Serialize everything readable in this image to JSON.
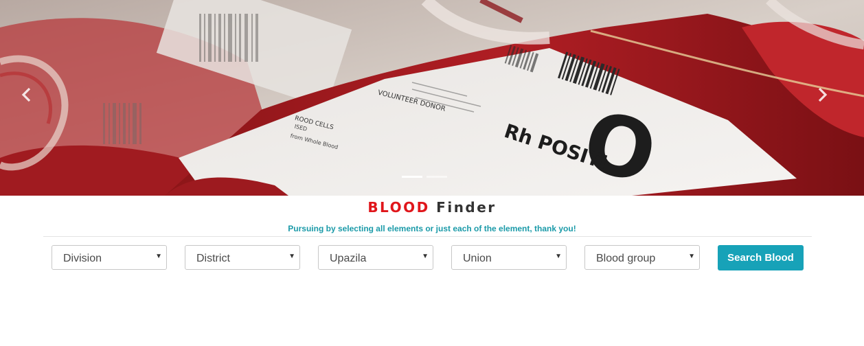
{
  "carousel": {
    "prev_icon": "chevron-left-icon",
    "next_icon": "chevron-right-icon",
    "indicator_count": 2,
    "active_indicator": 1,
    "bag_label_big": "O",
    "bag_label_rh": "Rh POSITI",
    "bag_small_text": {
      "donor": "VOLUNTEER DONOR",
      "cells": "ROOD CELLS",
      "line1": "ISED",
      "line2": "from Whole Blood"
    }
  },
  "title": {
    "word1": "BLOOD",
    "word2": "Finder",
    "word1_color": "#e0161b",
    "word2_color": "#333333"
  },
  "subtitle": "Pursuing by selecting all elements or just each of the element, thank you!",
  "filters": [
    {
      "label": "Division"
    },
    {
      "label": "District"
    },
    {
      "label": "Upazila"
    },
    {
      "label": "Union"
    },
    {
      "label": "Blood group"
    }
  ],
  "search_button": "Search Blood",
  "accent_color": "#17a2b8"
}
